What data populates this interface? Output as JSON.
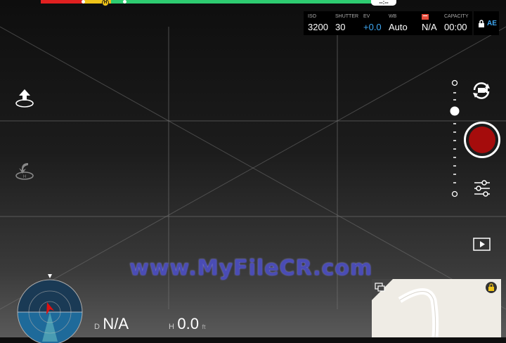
{
  "camera": {
    "iso": {
      "label": "ISO",
      "value": "3200"
    },
    "shutter": {
      "label": "SHUTTER",
      "value": "30"
    },
    "ev": {
      "label": "EV",
      "value": "+0.0"
    },
    "wb": {
      "label": "WB",
      "value": "Auto"
    },
    "format": {
      "value": "N/A"
    },
    "capacity": {
      "label": "CAPACITY",
      "value": "00:00"
    },
    "ae": "AE"
  },
  "flight_time": "--:--",
  "battery_marker": "H",
  "watermark": "www.MyFileCR.com",
  "telemetry": {
    "distance": {
      "label": "D",
      "value": "N/A"
    },
    "height": {
      "label": "H",
      "value": "0.0",
      "unit": "ft"
    }
  },
  "icons": [
    "takeoff-icon",
    "return-home-icon",
    "camera-mode-switch-icon",
    "record-button",
    "settings-sliders-icon",
    "playback-icon",
    "lock-icon",
    "map-collapse-icon"
  ],
  "colors": {
    "record": "#a50c0c",
    "accent": "#3fa9f5",
    "battery_ok": "#2ecc71",
    "battery_low": "#e02020",
    "battery_warn": "#f0c419"
  }
}
